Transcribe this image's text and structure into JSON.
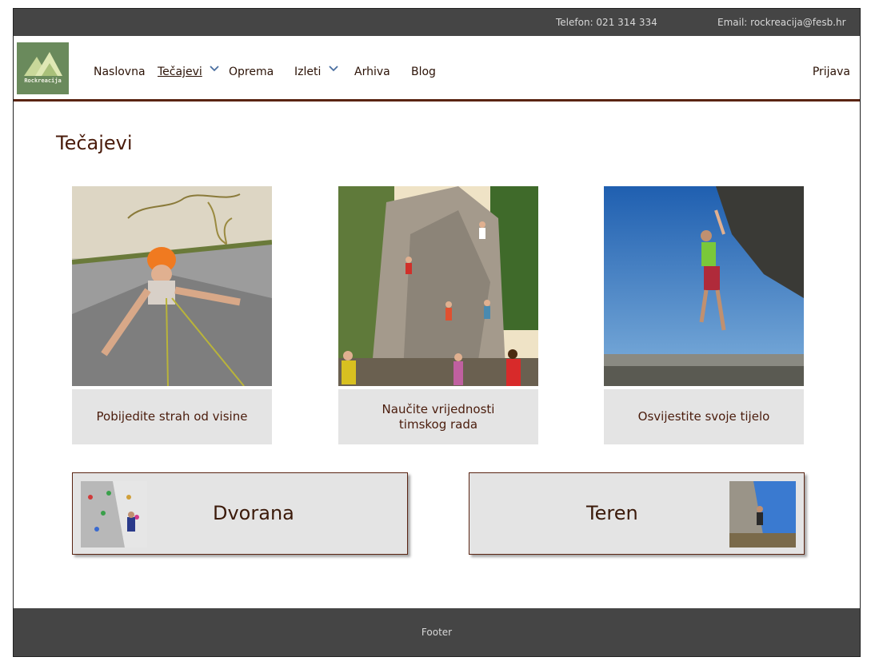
{
  "topbar": {
    "phone": "Telefon: 021 314 334",
    "email": "Email: rockreacija@fesb.hr"
  },
  "brand": {
    "logo_text": "Rockreacija",
    "logo_color": "#6a8a5c"
  },
  "nav": {
    "items": [
      {
        "label": "Naslovna"
      },
      {
        "label": "Tečajevi",
        "active": true,
        "has_dropdown": true
      },
      {
        "label": "Oprema"
      },
      {
        "label": "Izleti",
        "has_dropdown": true
      },
      {
        "label": "Arhiva"
      },
      {
        "label": "Blog"
      }
    ],
    "login": "Prijava"
  },
  "main": {
    "title": "Tečajevi",
    "cards": [
      {
        "caption": "Pobijedite strah od visine"
      },
      {
        "caption": "Naučite vrijednosti timskog rada"
      },
      {
        "caption": "Osvijestite svoje tijelo"
      }
    ],
    "buttons": [
      {
        "label": "Dvorana"
      },
      {
        "label": "Teren"
      }
    ]
  },
  "footer": {
    "label": "Footer"
  },
  "colors": {
    "dark_bar": "#454545",
    "accent": "#5a2412",
    "caption_bg": "#e4e4e4",
    "chevron": "#4a6fa0"
  }
}
